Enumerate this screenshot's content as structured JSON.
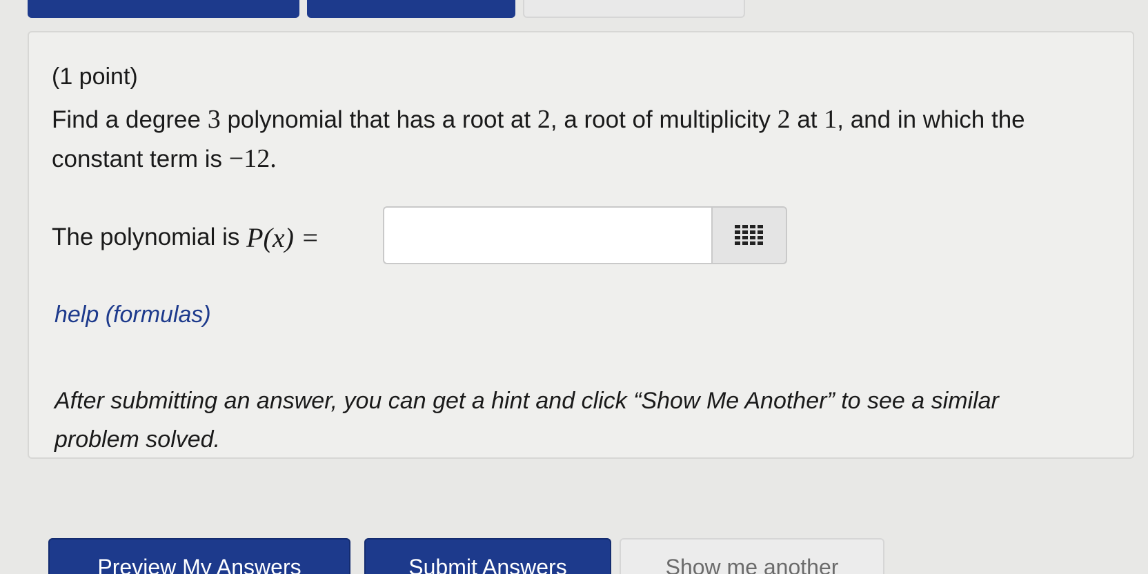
{
  "problem": {
    "points": "(1 point)",
    "text_prefix": "Find a degree ",
    "degree": "3",
    "text_mid1": " polynomial that has a root at ",
    "root": "2",
    "text_mid2": ", a root of multiplicity ",
    "multiplicity": "2",
    "text_mid3": " at ",
    "multiple_root": "1",
    "text_mid4": ", and in which the constant term is ",
    "constant": "−12",
    "text_end": "."
  },
  "answer": {
    "label": "The polynomial is ",
    "math_label": "P(x) =",
    "value": "",
    "keypad_icon": "keypad-icon"
  },
  "help_link": "help (formulas)",
  "hint_text": "After submitting an answer, you can get a hint and click “Show Me Another” to see a similar problem solved.",
  "buttons": {
    "preview": "Preview My Answers",
    "submit": "Submit Answers",
    "show_another": "Show me another"
  },
  "colors": {
    "primary": "#1d3a8c",
    "panel": "#efefed",
    "background": "#e8e8e6"
  }
}
